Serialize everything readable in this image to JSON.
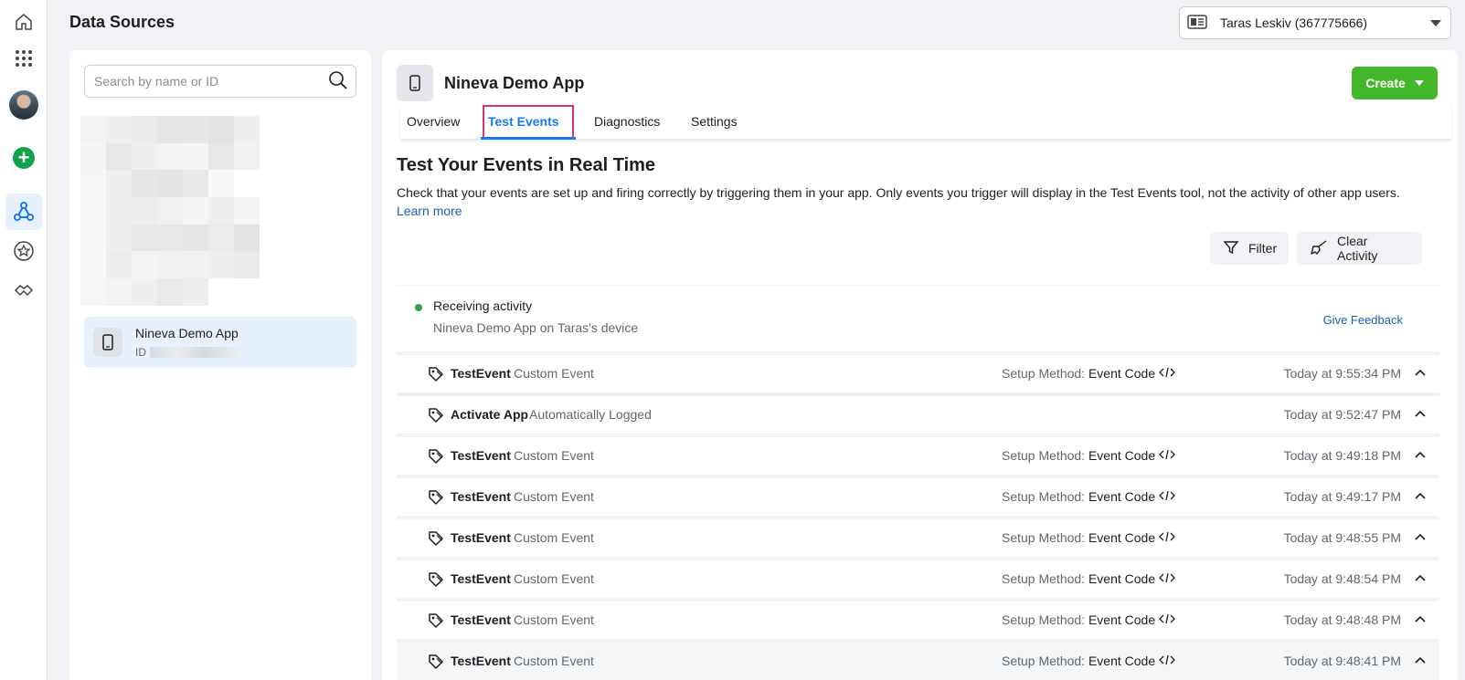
{
  "header": {
    "title": "Data Sources",
    "account_name": "Taras Leskiv (367775666)"
  },
  "sidebar": {
    "search_placeholder": "Search by name or ID",
    "app_card": {
      "name": "Nineva Demo App",
      "id_label": "ID"
    }
  },
  "main": {
    "app_title": "Nineva Demo App",
    "create_label": "Create",
    "tabs": [
      {
        "label": "Overview"
      },
      {
        "label": "Test Events"
      },
      {
        "label": "Diagnostics"
      },
      {
        "label": "Settings"
      }
    ],
    "active_tab": "Test Events",
    "section_title": "Test Your Events in Real Time",
    "description": "Check that your events are set up and firing correctly by triggering them in your app. Only events you trigger will display in the Test Events tool, not the activity of other app users.",
    "learn_more": "Learn more",
    "filter_label": "Filter",
    "clear_label": "Clear Activity",
    "status": {
      "title": "Receiving activity",
      "subtitle": "Nineva Demo App on Taras's device",
      "feedback": "Give Feedback",
      "indicator_color": "#31a24c"
    },
    "setup_prefix": "Setup Method:",
    "setup_value": "Event Code",
    "events": [
      {
        "name": "TestEvent",
        "type": "Custom Event",
        "has_setup": true,
        "time": "Today at 9:55:34 PM"
      },
      {
        "name": "Activate App",
        "type": "Automatically Logged",
        "has_setup": false,
        "time": "Today at 9:52:47 PM"
      },
      {
        "name": "TestEvent",
        "type": "Custom Event",
        "has_setup": true,
        "time": "Today at 9:49:18 PM"
      },
      {
        "name": "TestEvent",
        "type": "Custom Event",
        "has_setup": true,
        "time": "Today at 9:49:17 PM"
      },
      {
        "name": "TestEvent",
        "type": "Custom Event",
        "has_setup": true,
        "time": "Today at 9:48:55 PM"
      },
      {
        "name": "TestEvent",
        "type": "Custom Event",
        "has_setup": true,
        "time": "Today at 9:48:54 PM"
      },
      {
        "name": "TestEvent",
        "type": "Custom Event",
        "has_setup": true,
        "time": "Today at 9:48:48 PM"
      },
      {
        "name": "TestEvent",
        "type": "Custom Event",
        "has_setup": true,
        "time": "Today at 9:48:41 PM"
      }
    ]
  },
  "colors": {
    "accent": "#1877f2",
    "create_green": "#42b72a",
    "highlight": "#e0307a"
  },
  "icons": [
    "home-icon",
    "apps-grid-icon",
    "avatar",
    "add-icon",
    "data-sources-icon",
    "star-icon",
    "partner-handshake-icon",
    "account-card-icon",
    "search-icon",
    "mobile-icon",
    "filter-icon",
    "broom-icon",
    "tag-icon",
    "code-icon",
    "chevron-up-icon"
  ]
}
